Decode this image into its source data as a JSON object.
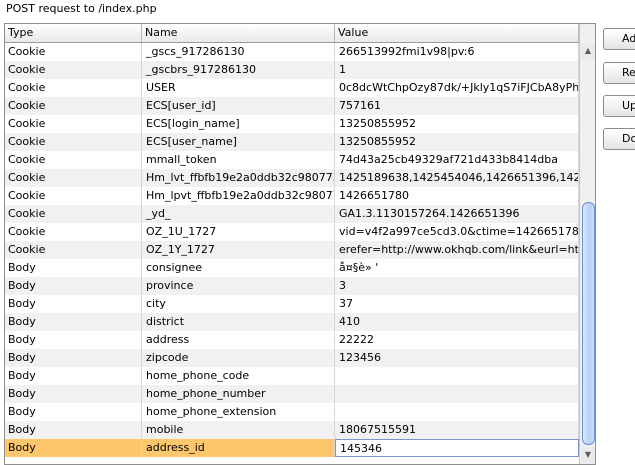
{
  "title": "POST request to /index.php",
  "columns": [
    "Type",
    "Name",
    "Value"
  ],
  "rows": [
    {
      "type": "Cookie",
      "name": "_gscs_917286130",
      "value": "266513992fmi1v98|pv:6"
    },
    {
      "type": "Cookie",
      "name": "_gscbrs_917286130",
      "value": "1"
    },
    {
      "type": "Cookie",
      "name": "USER",
      "value": "0c8dcWtChpOzy87dk/+Jkly1qS7iFJCbA8yPhe..."
    },
    {
      "type": "Cookie",
      "name": "ECS[user_id]",
      "value": "757161"
    },
    {
      "type": "Cookie",
      "name": "ECS[login_name]",
      "value": "13250855952"
    },
    {
      "type": "Cookie",
      "name": "ECS[user_name]",
      "value": "13250855952"
    },
    {
      "type": "Cookie",
      "name": "mmall_token",
      "value": "74d43a25cb49329af721d433b8414dba"
    },
    {
      "type": "Cookie",
      "name": "Hm_lvt_ffbfb19e2a0ddb32c980773...",
      "value": "1425189638,1425454046,1426651396,142665..."
    },
    {
      "type": "Cookie",
      "name": "Hm_lpvt_ffbfb19e2a0ddb32c98077...",
      "value": "1426651780"
    },
    {
      "type": "Cookie",
      "name": "_yd_",
      "value": "GA1.3.1130157264.1426651396"
    },
    {
      "type": "Cookie",
      "name": "OZ_1U_1727",
      "value": "vid=v4f2a997ce5cd3.0&ctime=1426651786&lti..."
    },
    {
      "type": "Cookie",
      "name": "OZ_1Y_1727",
      "value": "erefer=http://www.okhqb.com/link&eurl=http:/..."
    },
    {
      "type": "Body",
      "name": "consignee",
      "value": "å¤§è» '"
    },
    {
      "type": "Body",
      "name": "province",
      "value": "3"
    },
    {
      "type": "Body",
      "name": "city",
      "value": "37"
    },
    {
      "type": "Body",
      "name": "district",
      "value": "410"
    },
    {
      "type": "Body",
      "name": "address",
      "value": "22222"
    },
    {
      "type": "Body",
      "name": "zipcode",
      "value": "123456"
    },
    {
      "type": "Body",
      "name": "home_phone_code",
      "value": ""
    },
    {
      "type": "Body",
      "name": "home_phone_number",
      "value": ""
    },
    {
      "type": "Body",
      "name": "home_phone_extension",
      "value": ""
    },
    {
      "type": "Body",
      "name": "mobile",
      "value": "18067515591"
    },
    {
      "type": "Body",
      "name": "address_id",
      "value": "145346"
    }
  ],
  "selected_row": 22,
  "buttons": {
    "add": "Add",
    "remove": "Remove",
    "up": "Up",
    "down": "Down"
  },
  "colors": {
    "selected_row": "#ffc76b",
    "alt_row": "#f1f1f1",
    "scroll_thumb": "#b9d0f4"
  }
}
